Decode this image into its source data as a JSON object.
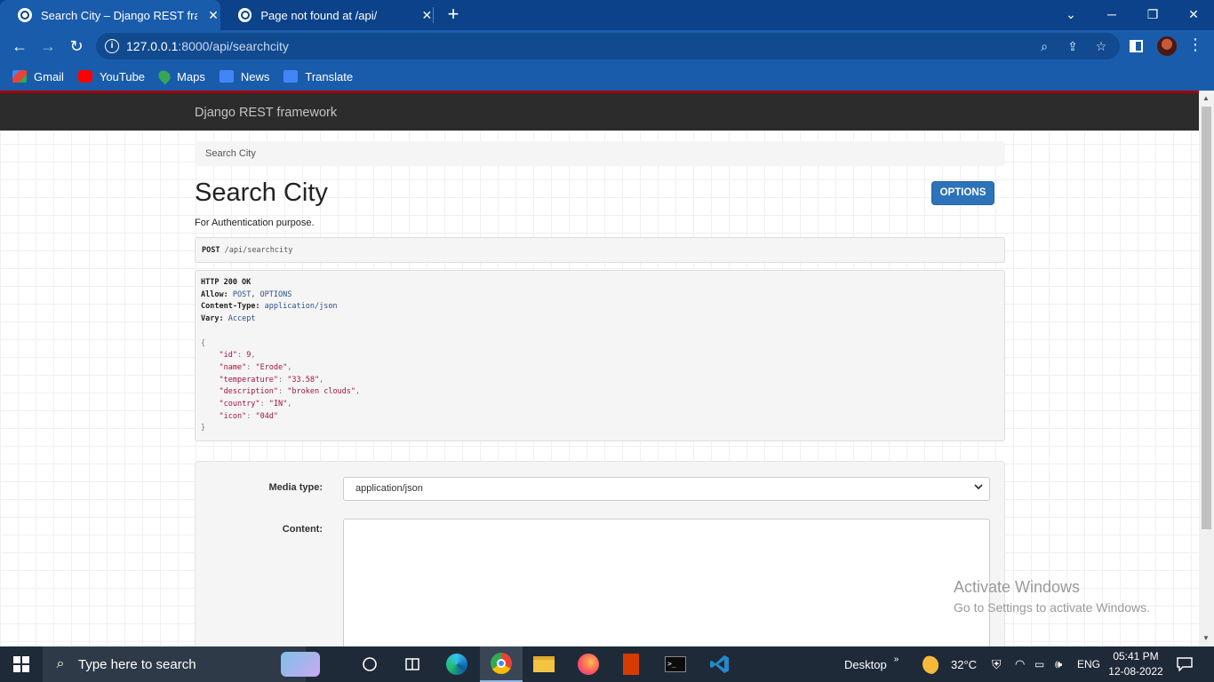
{
  "browser": {
    "tabs": [
      {
        "title": "Search City – Django REST frame",
        "active": true
      },
      {
        "title": "Page not found at /api/",
        "active": false
      }
    ],
    "url_host": "127.0.0.1",
    "url_rest": ":8000/api/searchcity",
    "bookmarks": [
      {
        "label": "Gmail",
        "icon": "gmail-icon",
        "color": "#ea4335"
      },
      {
        "label": "YouTube",
        "icon": "youtube-icon",
        "color": "#ff0000"
      },
      {
        "label": "Maps",
        "icon": "maps-icon",
        "color": "#34a853"
      },
      {
        "label": "News",
        "icon": "news-icon",
        "color": "#4285f4"
      },
      {
        "label": "Translate",
        "icon": "translate-icon",
        "color": "#4285f4"
      }
    ]
  },
  "drf": {
    "brand": "Django REST framework",
    "breadcrumb": "Search City",
    "title": "Search City",
    "options_label": "OPTIONS",
    "description": "For Authentication purpose.",
    "request": {
      "method": "POST",
      "path": "/api/searchcity"
    },
    "response": {
      "status": "HTTP 200 OK",
      "headers": [
        {
          "name": "Allow",
          "value": "POST, OPTIONS"
        },
        {
          "name": "Content-Type",
          "value": "application/json"
        },
        {
          "name": "Vary",
          "value": "Accept"
        }
      ],
      "body": [
        {
          "key": "\"id\"",
          "value": "9",
          "comma": ","
        },
        {
          "key": "\"name\"",
          "value": "\"Erode\"",
          "comma": ","
        },
        {
          "key": "\"temperature\"",
          "value": "\"33.58\"",
          "comma": ","
        },
        {
          "key": "\"description\"",
          "value": "\"broken clouds\"",
          "comma": ","
        },
        {
          "key": "\"country\"",
          "value": "\"IN\"",
          "comma": ","
        },
        {
          "key": "\"icon\"",
          "value": "\"04d\"",
          "comma": ""
        }
      ]
    },
    "form": {
      "media_type_label": "Media type:",
      "media_type_value": "application/json",
      "content_label": "Content:"
    }
  },
  "watermark": {
    "line1": "Activate Windows",
    "line2": "Go to Settings to activate Windows."
  },
  "taskbar": {
    "search_placeholder": "Type here to search",
    "desktop_label": "Desktop",
    "weather": "32°C",
    "language": "ENG",
    "time": "05:41 PM",
    "date": "12-08-2022"
  },
  "colors": {
    "drf_navbar": "#2c2c2c",
    "drf_red": "#a30000",
    "options_blue": "#2d73b9",
    "chrome_blue": "#1a5cac"
  }
}
